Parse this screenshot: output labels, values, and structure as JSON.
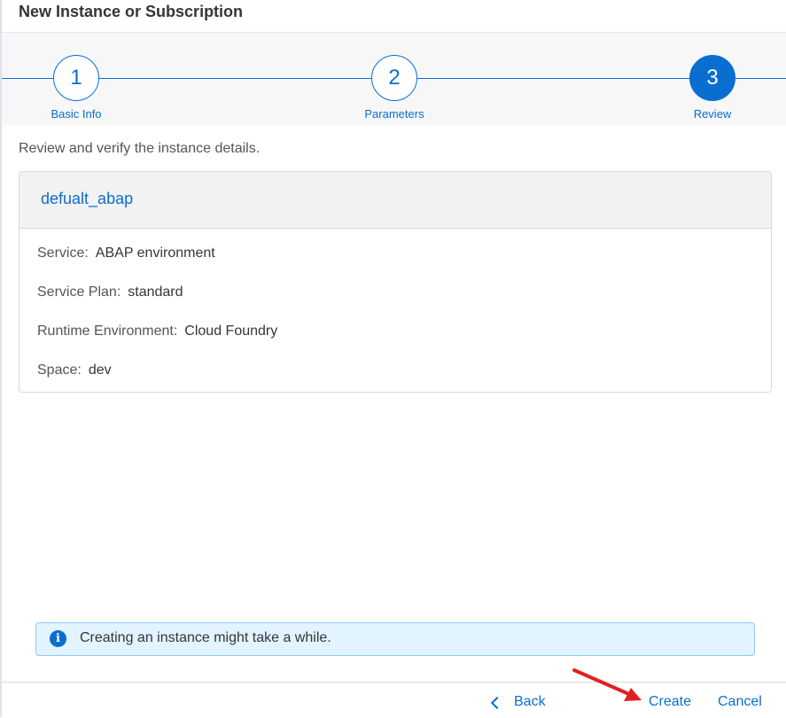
{
  "dialog": {
    "title": "New Instance or Subscription"
  },
  "steps": [
    {
      "number": "1",
      "label": "Basic Info",
      "state": "completed"
    },
    {
      "number": "2",
      "label": "Parameters",
      "state": "completed"
    },
    {
      "number": "3",
      "label": "Review",
      "state": "active"
    }
  ],
  "review": {
    "intro": "Review and verify the instance details.",
    "instance_name": "defualt_abap",
    "details": [
      {
        "label": "Service:",
        "value": "ABAP environment"
      },
      {
        "label": "Service Plan:",
        "value": "standard"
      },
      {
        "label": "Runtime Environment:",
        "value": "Cloud Foundry"
      },
      {
        "label": "Space:",
        "value": "dev"
      }
    ]
  },
  "info": {
    "icon": "info-icon",
    "text": "Creating an instance might take a while."
  },
  "footer": {
    "back_label": "Back",
    "create_label": "Create",
    "cancel_label": "Cancel"
  },
  "colors": {
    "accent": "#0a6ed1",
    "info_background": "#e1f4ff",
    "annotation_arrow": "#e02020"
  }
}
